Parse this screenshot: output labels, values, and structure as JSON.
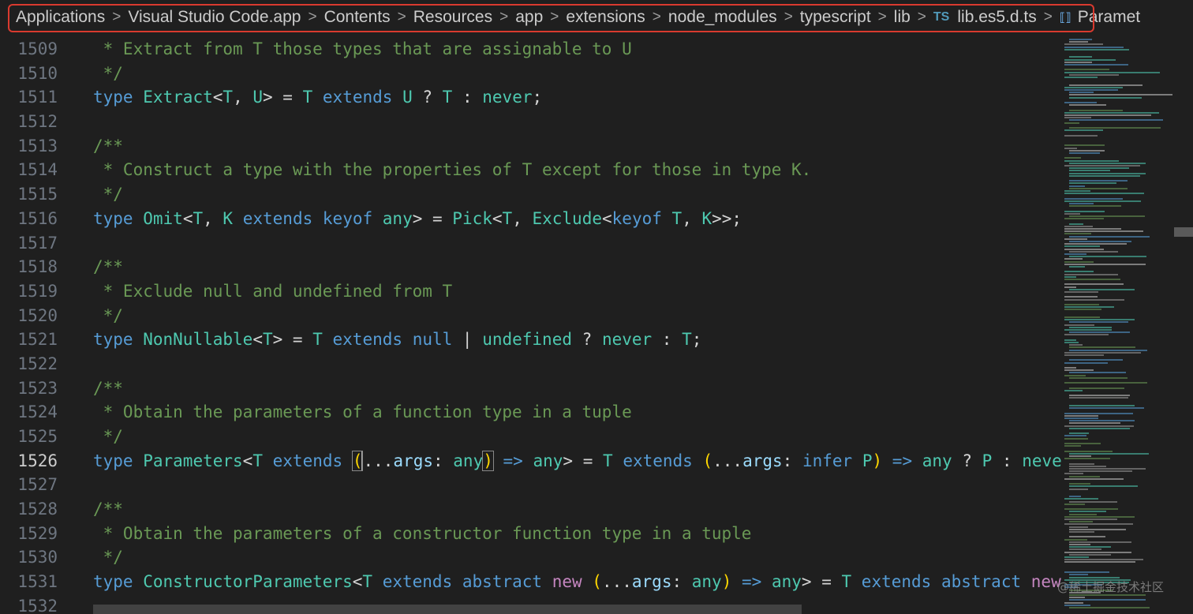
{
  "breadcrumb": {
    "items": [
      "Applications",
      "Visual Studio Code.app",
      "Contents",
      "Resources",
      "app",
      "extensions",
      "node_modules",
      "typescript",
      "lib"
    ],
    "file_icon": "TS",
    "file": "lib.es5.d.ts",
    "symbol_icon": "symbol-icon",
    "symbol": "Paramet",
    "separator": ">"
  },
  "editor": {
    "active_line": "1526",
    "lines": [
      {
        "n": "1509",
        "t": [
          [
            "cm",
            " * Extract from T those types that are assignable to U"
          ]
        ]
      },
      {
        "n": "1510",
        "t": [
          [
            "cm",
            " */"
          ]
        ]
      },
      {
        "n": "1511",
        "t": [
          [
            "kw",
            "type"
          ],
          [
            "op",
            " "
          ],
          [
            "type",
            "Extract"
          ],
          [
            "op",
            "<"
          ],
          [
            "type",
            "T"
          ],
          [
            "op",
            ", "
          ],
          [
            "type",
            "U"
          ],
          [
            "op",
            "> = "
          ],
          [
            "type",
            "T"
          ],
          [
            "op",
            " "
          ],
          [
            "kw",
            "extends"
          ],
          [
            "op",
            " "
          ],
          [
            "type",
            "U"
          ],
          [
            "op",
            " ? "
          ],
          [
            "type",
            "T"
          ],
          [
            "op",
            " : "
          ],
          [
            "type",
            "never"
          ],
          [
            "op",
            ";"
          ]
        ]
      },
      {
        "n": "1512",
        "t": []
      },
      {
        "n": "1513",
        "t": [
          [
            "cm",
            "/**"
          ]
        ]
      },
      {
        "n": "1514",
        "t": [
          [
            "cm",
            " * Construct a type with the properties of T except for those in type K."
          ]
        ]
      },
      {
        "n": "1515",
        "t": [
          [
            "cm",
            " */"
          ]
        ]
      },
      {
        "n": "1516",
        "t": [
          [
            "kw",
            "type"
          ],
          [
            "op",
            " "
          ],
          [
            "type",
            "Omit"
          ],
          [
            "op",
            "<"
          ],
          [
            "type",
            "T"
          ],
          [
            "op",
            ", "
          ],
          [
            "type",
            "K"
          ],
          [
            "op",
            " "
          ],
          [
            "kw",
            "extends"
          ],
          [
            "op",
            " "
          ],
          [
            "kw",
            "keyof"
          ],
          [
            "op",
            " "
          ],
          [
            "type",
            "any"
          ],
          [
            "op",
            "> = "
          ],
          [
            "type",
            "Pick"
          ],
          [
            "op",
            "<"
          ],
          [
            "type",
            "T"
          ],
          [
            "op",
            ", "
          ],
          [
            "type",
            "Exclude"
          ],
          [
            "op",
            "<"
          ],
          [
            "kw",
            "keyof"
          ],
          [
            "op",
            " "
          ],
          [
            "type",
            "T"
          ],
          [
            "op",
            ", "
          ],
          [
            "type",
            "K"
          ],
          [
            "op",
            ">>;"
          ]
        ]
      },
      {
        "n": "1517",
        "t": []
      },
      {
        "n": "1518",
        "t": [
          [
            "cm",
            "/**"
          ]
        ]
      },
      {
        "n": "1519",
        "t": [
          [
            "cm",
            " * Exclude null and undefined from T"
          ]
        ]
      },
      {
        "n": "1520",
        "t": [
          [
            "cm",
            " */"
          ]
        ]
      },
      {
        "n": "1521",
        "t": [
          [
            "kw",
            "type"
          ],
          [
            "op",
            " "
          ],
          [
            "type",
            "NonNullable"
          ],
          [
            "op",
            "<"
          ],
          [
            "type",
            "T"
          ],
          [
            "op",
            "> = "
          ],
          [
            "type",
            "T"
          ],
          [
            "op",
            " "
          ],
          [
            "kw",
            "extends"
          ],
          [
            "op",
            " "
          ],
          [
            "kw",
            "null"
          ],
          [
            "op",
            " | "
          ],
          [
            "type",
            "undefined"
          ],
          [
            "op",
            " ? "
          ],
          [
            "type",
            "never"
          ],
          [
            "op",
            " : "
          ],
          [
            "type",
            "T"
          ],
          [
            "op",
            ";"
          ]
        ]
      },
      {
        "n": "1522",
        "t": []
      },
      {
        "n": "1523",
        "t": [
          [
            "cm",
            "/**"
          ]
        ]
      },
      {
        "n": "1524",
        "t": [
          [
            "cm",
            " * Obtain the parameters of a function type in a tuple"
          ]
        ]
      },
      {
        "n": "1525",
        "t": [
          [
            "cm",
            " */"
          ]
        ]
      },
      {
        "n": "1526",
        "t": [
          [
            "kw",
            "type"
          ],
          [
            "op",
            " "
          ],
          [
            "type",
            "Parameters"
          ],
          [
            "op",
            "<"
          ],
          [
            "type",
            "T"
          ],
          [
            "op",
            " "
          ],
          [
            "kw",
            "extends"
          ],
          [
            "op",
            " "
          ],
          [
            "bm",
            "("
          ],
          [
            "cur",
            ""
          ],
          [
            "op",
            "..."
          ],
          [
            "par",
            "args"
          ],
          [
            "op",
            ": "
          ],
          [
            "type",
            "any"
          ],
          [
            "bm",
            ")"
          ],
          [
            "op",
            " "
          ],
          [
            "kw",
            "=>"
          ],
          [
            "op",
            " "
          ],
          [
            "type",
            "any"
          ],
          [
            "op",
            "> = "
          ],
          [
            "type",
            "T"
          ],
          [
            "op",
            " "
          ],
          [
            "kw",
            "extends"
          ],
          [
            "op",
            " "
          ],
          [
            "p1",
            "("
          ],
          [
            "op",
            "..."
          ],
          [
            "par",
            "args"
          ],
          [
            "op",
            ": "
          ],
          [
            "kw",
            "infer"
          ],
          [
            "op",
            " "
          ],
          [
            "type",
            "P"
          ],
          [
            "p1",
            ")"
          ],
          [
            "op",
            " "
          ],
          [
            "kw",
            "=>"
          ],
          [
            "op",
            " "
          ],
          [
            "type",
            "any"
          ],
          [
            "op",
            " ? "
          ],
          [
            "type",
            "P"
          ],
          [
            "op",
            " : "
          ],
          [
            "type",
            "never"
          ],
          [
            "op",
            ";"
          ]
        ]
      },
      {
        "n": "1527",
        "t": []
      },
      {
        "n": "1528",
        "t": [
          [
            "cm",
            "/**"
          ]
        ]
      },
      {
        "n": "1529",
        "t": [
          [
            "cm",
            " * Obtain the parameters of a constructor function type in a tuple"
          ]
        ]
      },
      {
        "n": "1530",
        "t": [
          [
            "cm",
            " */"
          ]
        ]
      },
      {
        "n": "1531",
        "t": [
          [
            "kw",
            "type"
          ],
          [
            "op",
            " "
          ],
          [
            "type",
            "ConstructorParameters"
          ],
          [
            "op",
            "<"
          ],
          [
            "type",
            "T"
          ],
          [
            "op",
            " "
          ],
          [
            "kw",
            "extends"
          ],
          [
            "op",
            " "
          ],
          [
            "kw",
            "abstract"
          ],
          [
            "op",
            " "
          ],
          [
            "ctl",
            "new"
          ],
          [
            "op",
            " "
          ],
          [
            "p1",
            "("
          ],
          [
            "op",
            "..."
          ],
          [
            "par",
            "args"
          ],
          [
            "op",
            ": "
          ],
          [
            "type",
            "any"
          ],
          [
            "p1",
            ")"
          ],
          [
            "op",
            " "
          ],
          [
            "kw",
            "=>"
          ],
          [
            "op",
            " "
          ],
          [
            "type",
            "any"
          ],
          [
            "op",
            "> = "
          ],
          [
            "type",
            "T"
          ],
          [
            "op",
            " "
          ],
          [
            "kw",
            "extends"
          ],
          [
            "op",
            " "
          ],
          [
            "kw",
            "abstract"
          ],
          [
            "op",
            " "
          ],
          [
            "ctl",
            "new"
          ],
          [
            "op",
            " "
          ],
          [
            "p1",
            "("
          ]
        ]
      },
      {
        "n": "1532",
        "t": []
      }
    ]
  },
  "watermark": "@稀土掘金技术社区"
}
